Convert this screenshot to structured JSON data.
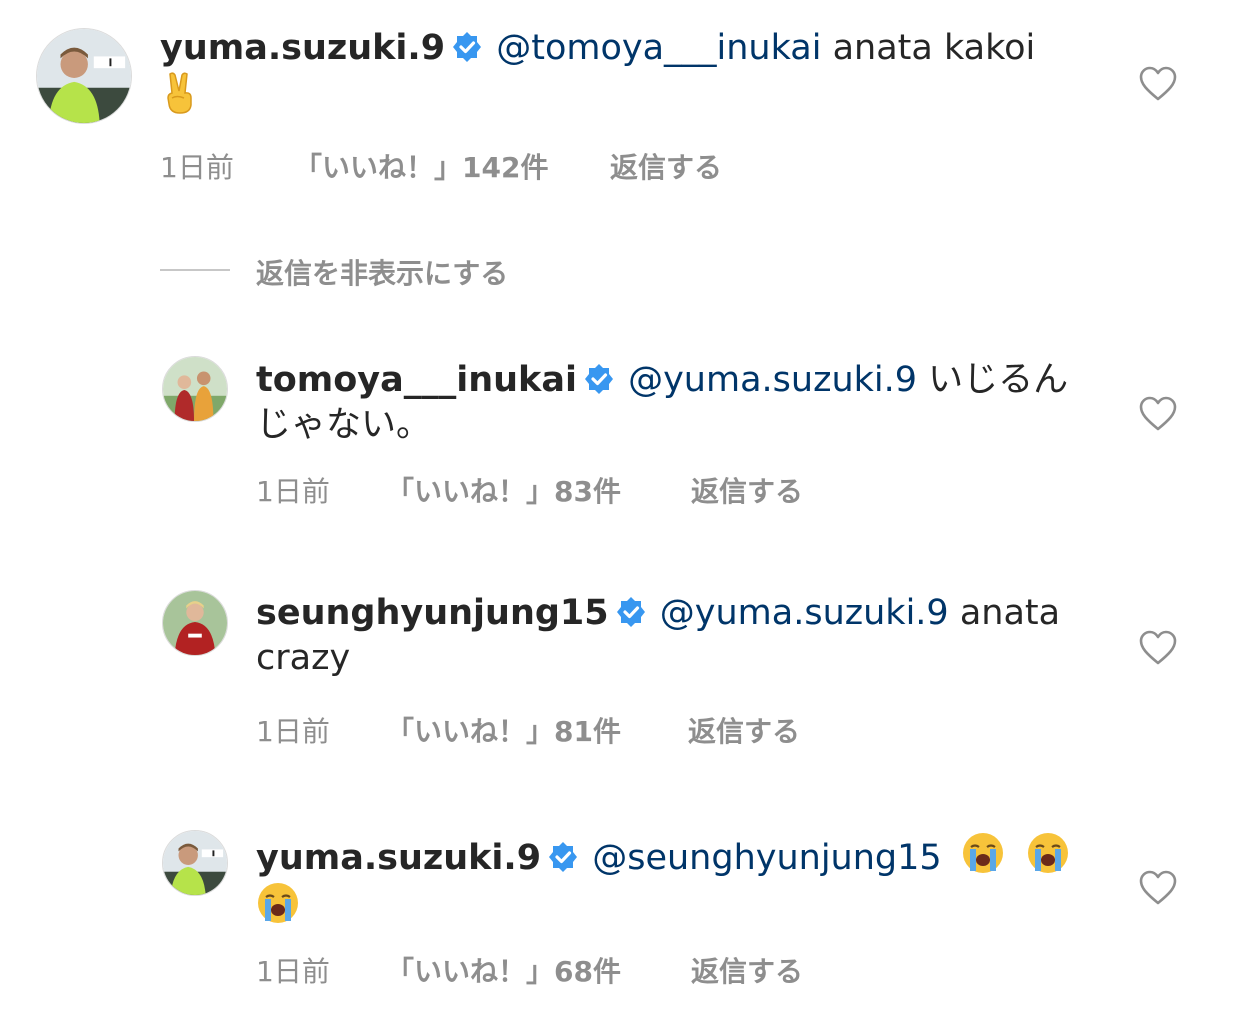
{
  "colors": {
    "text": "#262626",
    "secondary": "#8e8e8e",
    "mention": "#003569",
    "verified": "#3897f0"
  },
  "hide_replies_label": "返信を非表示にする",
  "comments": [
    {
      "username": "yuma.suzuki.9",
      "verified": true,
      "mention": "@tomoya___inukai",
      "text_after": "anata kakoi",
      "text_line2": "",
      "emojis": [
        "victory-hand"
      ],
      "time": "1日前",
      "likes": "「いいね！」142件",
      "reply": "返信する",
      "avatar_icon": "player-avatar-green-kit"
    },
    {
      "username": "tomoya___inukai",
      "verified": true,
      "mention": "@yuma.suzuki.9",
      "text_after": "いじるん",
      "text_line2": "じゃない。",
      "emojis": [],
      "time": "1日前",
      "likes": "「いいね！」83件",
      "reply": "返信する",
      "avatar_icon": "two-people-avatar"
    },
    {
      "username": "seunghyunjung15",
      "verified": true,
      "mention": "@yuma.suzuki.9",
      "text_after": "anata",
      "text_line2": "crazy",
      "emojis": [],
      "time": "1日前",
      "likes": "「いいね！」81件",
      "reply": "返信する",
      "avatar_icon": "player-avatar-red-kit"
    },
    {
      "username": "yuma.suzuki.9",
      "verified": true,
      "mention": "@seunghyunjung15",
      "text_after": "",
      "text_line2": "",
      "emojis": [
        "loudly-crying-face",
        "loudly-crying-face",
        "loudly-crying-face"
      ],
      "time": "1日前",
      "likes": "「いいね！」68件",
      "reply": "返信する",
      "avatar_icon": "player-avatar-green-kit"
    }
  ]
}
